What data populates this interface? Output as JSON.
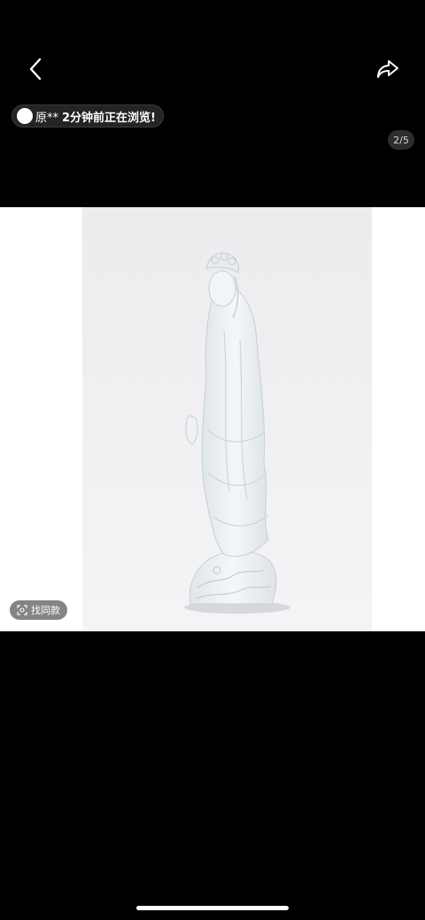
{
  "header": {
    "back_icon": "chevron-left-icon",
    "share_icon": "share-forward-icon"
  },
  "viewer_notice": {
    "name": "原**",
    "text": "2分钟前正在浏览!"
  },
  "gallery": {
    "counter": "2/5"
  },
  "find_same": {
    "icon": "scan-icon",
    "label": "找同款"
  },
  "colors": {
    "background": "#000000",
    "image_bg": "#f1f1f3",
    "statue": "#e9eef0"
  }
}
